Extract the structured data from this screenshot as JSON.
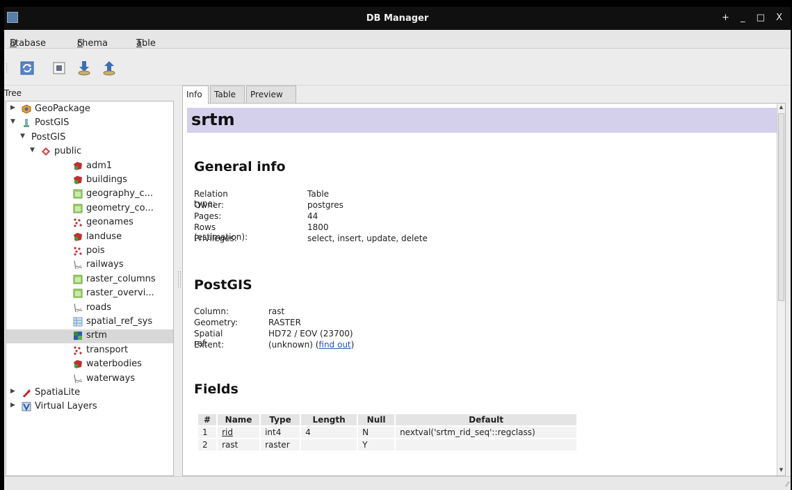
{
  "window": {
    "title": "DB Manager",
    "controls": "+ _ □ X"
  },
  "menu": [
    {
      "pre": "",
      "u": "D",
      "post": "atabase"
    },
    {
      "pre": "",
      "u": "S",
      "post": "chema"
    },
    {
      "pre": "",
      "u": "T",
      "post": "able"
    }
  ],
  "toolbar": {
    "buttons": [
      {
        "icon": "refresh-icon"
      },
      {
        "icon": "sql-window-icon"
      },
      {
        "icon": "import-layer-icon"
      },
      {
        "icon": "export-layer-icon"
      }
    ]
  },
  "tree": {
    "header": "Tree",
    "items": [
      {
        "label": "GeoPackage",
        "icon": "geopackage-icon",
        "arrow": "▶",
        "level": 0
      },
      {
        "label": "PostGIS",
        "icon": "postgis-icon",
        "arrow": "▼",
        "level": 0
      },
      {
        "label": "PostGIS",
        "icon": "",
        "arrow": "▼",
        "level": 1
      },
      {
        "label": "public",
        "icon": "schema-icon",
        "arrow": "▼",
        "level": 2
      },
      {
        "label": "adm1",
        "icon": "polygon-layer-icon",
        "arrow": "",
        "level": 3
      },
      {
        "label": "buildings",
        "icon": "polygon-layer-icon",
        "arrow": "",
        "level": 3
      },
      {
        "label": "geography_c...",
        "icon": "table-icon",
        "arrow": "",
        "level": 3
      },
      {
        "label": "geometry_co...",
        "icon": "table-icon",
        "arrow": "",
        "level": 3
      },
      {
        "label": "geonames",
        "icon": "point-layer-icon",
        "arrow": "",
        "level": 3
      },
      {
        "label": "landuse",
        "icon": "polygon-layer-icon",
        "arrow": "",
        "level": 3
      },
      {
        "label": "pois",
        "icon": "point-layer-icon",
        "arrow": "",
        "level": 3
      },
      {
        "label": "railways",
        "icon": "line-layer-icon",
        "arrow": "",
        "level": 3
      },
      {
        "label": "raster_columns",
        "icon": "table-icon",
        "arrow": "",
        "level": 3
      },
      {
        "label": "raster_overvi...",
        "icon": "table-icon",
        "arrow": "",
        "level": 3
      },
      {
        "label": "roads",
        "icon": "line-layer-icon",
        "arrow": "",
        "level": 3
      },
      {
        "label": "spatial_ref_sys",
        "icon": "plain-table-icon",
        "arrow": "",
        "level": 3
      },
      {
        "label": "srtm",
        "icon": "raster-layer-icon",
        "arrow": "",
        "level": 3,
        "selected": true
      },
      {
        "label": "transport",
        "icon": "point-layer-icon",
        "arrow": "",
        "level": 3
      },
      {
        "label": "waterbodies",
        "icon": "polygon-layer-icon",
        "arrow": "",
        "level": 3
      },
      {
        "label": "waterways",
        "icon": "line-layer-icon",
        "arrow": "",
        "level": 3
      },
      {
        "label": "SpatiaLite",
        "icon": "spatialite-icon",
        "arrow": "▶",
        "level": 0
      },
      {
        "label": "Virtual Layers",
        "icon": "virtual-layers-icon",
        "arrow": "▶",
        "level": 0
      }
    ]
  },
  "tabs": [
    {
      "label": "Info",
      "active": true
    },
    {
      "label": "Table",
      "active": false
    },
    {
      "label": "Preview",
      "active": false
    }
  ],
  "info": {
    "title": "srtm",
    "general_heading": "General info",
    "general": [
      {
        "key": "Relation type:",
        "value": "Table"
      },
      {
        "key": "Owner:",
        "value": "postgres"
      },
      {
        "key": "Pages:",
        "value": "44"
      },
      {
        "key": "Rows (estimation):",
        "value": "1800"
      },
      {
        "key": "Privileges:",
        "value": "select, insert, update, delete"
      }
    ],
    "postgis_heading": "PostGIS",
    "postgis": [
      {
        "key": "Column:",
        "value": "rast"
      },
      {
        "key": "Geometry:",
        "value": "RASTER"
      },
      {
        "key": "Spatial ref:",
        "value": "HD72 / EOV (23700)"
      },
      {
        "key": "Extent:",
        "value": "(unknown) (",
        "link": "find out",
        "after": ")"
      }
    ],
    "fields_heading": "Fields",
    "fields": {
      "headers": [
        "#",
        "Name",
        "Type",
        "Length",
        "Null",
        "Default"
      ],
      "rows": [
        [
          "1",
          "rid",
          "int4",
          "4",
          "N",
          "nextval('srtm_rid_seq'::regclass)"
        ],
        [
          "2",
          "rast",
          "raster",
          "",
          "Y",
          ""
        ]
      ]
    }
  }
}
